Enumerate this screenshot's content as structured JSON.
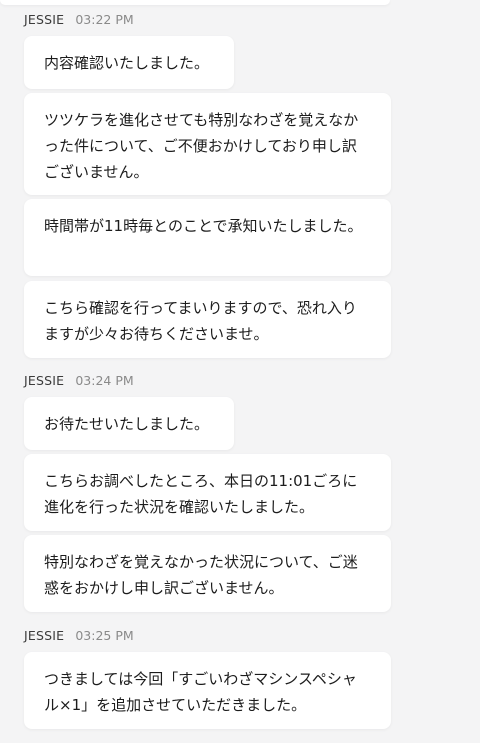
{
  "chat": {
    "groups": [
      {
        "sender": "JESSIE",
        "time": "03:22 PM",
        "messages": [
          "内容確認いたしました。",
          "ツツケラを進化させても特別なわざを覚えなかった件について、ご不便おかけしており申し訳ございません。",
          "時間帯が11時毎とのことで承知いたしました。",
          "こちら確認を行ってまいりますので、恐れ入りますが少々お待ちくださいませ。"
        ]
      },
      {
        "sender": "JESSIE",
        "time": "03:24 PM",
        "messages": [
          "お待たせいたしました。",
          "こちらお調べしたところ、本日の11:01ごろに進化を行った状況を確認いたしました。",
          "特別なわざを覚えなかった状況について、ご迷惑をおかけし申し訳ございません。"
        ]
      },
      {
        "sender": "JESSIE",
        "time": "03:25 PM",
        "messages": [
          "つきましては今回「すごいわざマシンスペシャル×1」を追加させていただきました。"
        ]
      }
    ]
  }
}
